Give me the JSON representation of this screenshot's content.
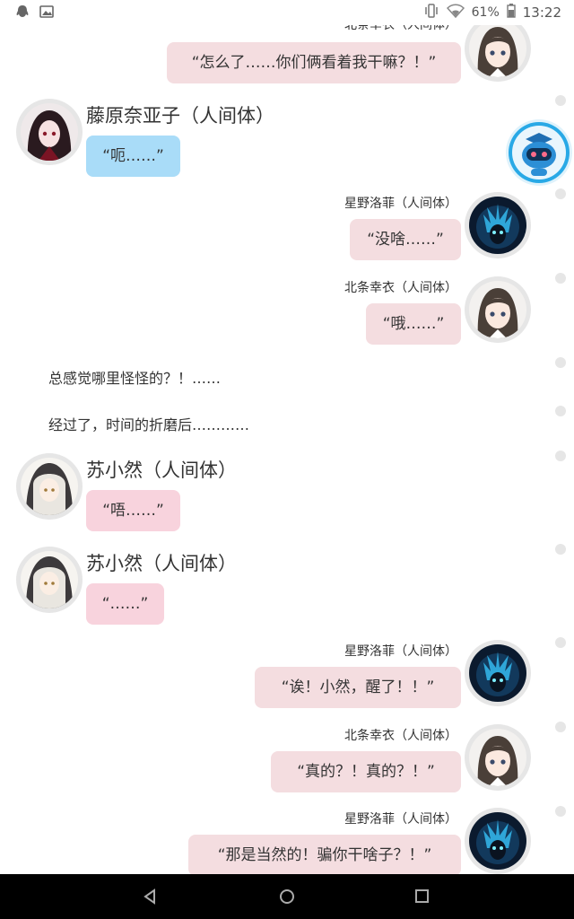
{
  "status_bar": {
    "left_icons": [
      "qq-icon",
      "image-icon"
    ],
    "right_icons": [
      "vibrate-icon",
      "wifi-icon",
      "battery-icon"
    ],
    "battery": "61%",
    "time": "13:22"
  },
  "messages": {
    "m0": {
      "speaker": "北条幸衣（人间体）",
      "text": "“怎么了……你们俩看着我干嘛？！”"
    },
    "m1": {
      "speaker": "藤原奈亚子（人间体）",
      "text": "“呃……”"
    },
    "m2": {
      "speaker": "星野洛菲（人间体）",
      "text": "“没啥……”"
    },
    "m3": {
      "speaker": "北条幸衣（人间体）",
      "text": "“哦……”"
    },
    "n1": {
      "text": "总感觉哪里怪怪的？！……"
    },
    "n2": {
      "text": "经过了，时间的折磨后…………"
    },
    "m4": {
      "speaker": "苏小然（人间体）",
      "text": "“唔……”"
    },
    "m5": {
      "speaker": "苏小然（人间体）",
      "text": "“……”"
    },
    "m6": {
      "speaker": "星野洛菲（人间体）",
      "text": "“诶！小然，醒了！！”"
    },
    "m7": {
      "speaker": "北条幸衣（人间体）",
      "text": "“真的？！真的？！”"
    },
    "m8": {
      "speaker": "星野洛菲（人间体）",
      "text": "“那是当然的！骗你干啥子？！”"
    }
  },
  "colors": {
    "bubble_pink": "#f4dde0",
    "bubble_pink_strong": "#f8d3dd",
    "bubble_blue": "#a9dcf8",
    "avatar_ring": "#e6e6e6",
    "nav_bg": "#000000"
  },
  "avatars": {
    "beitiao": "girl-long-hair-avatar",
    "fujiwara": "dark-red-girl-avatar",
    "xingye": "blue-spirit-avatar",
    "suxiaoran": "white-hood-girl-avatar",
    "bot": "robot-assistant-icon"
  },
  "nav": [
    "back-icon",
    "home-icon",
    "recents-icon"
  ]
}
